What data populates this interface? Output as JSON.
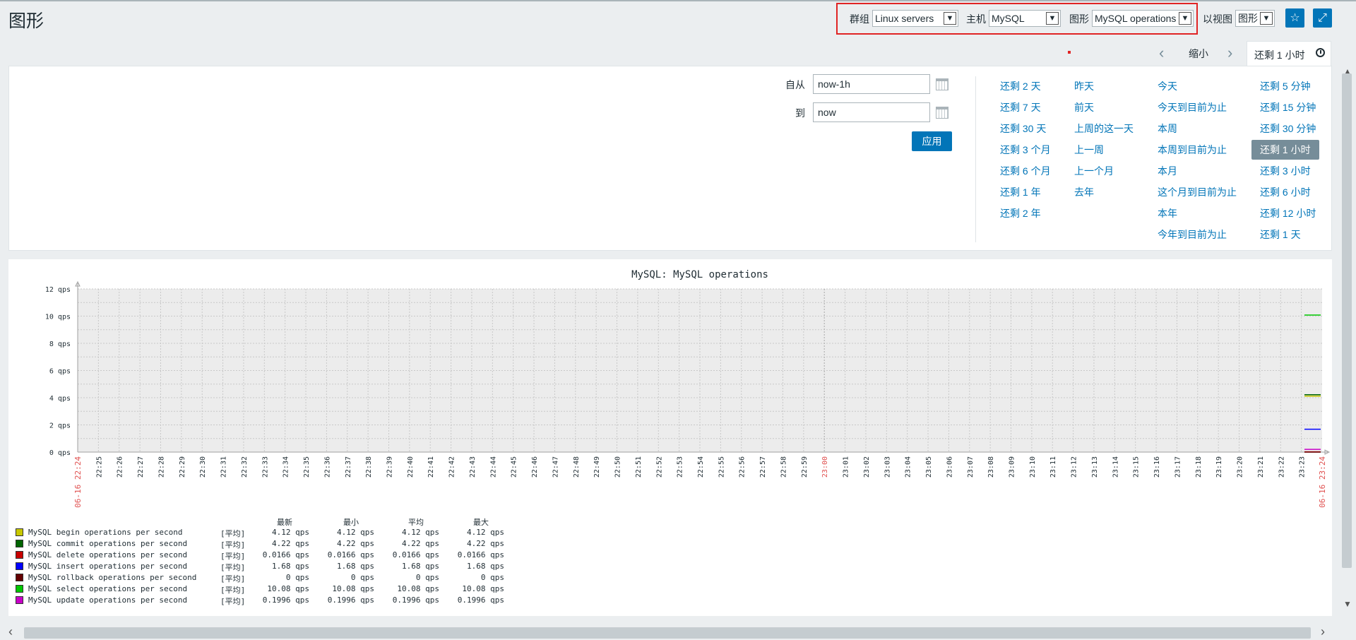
{
  "page": {
    "title": "图形"
  },
  "filters": {
    "group_label": "群组",
    "group_value": "Linux servers",
    "host_label": "主机",
    "host_value": "MySQL",
    "graph_label": "图形",
    "graph_value": "MySQL operations",
    "view_label": "以视图",
    "view_value": "图形"
  },
  "timebar": {
    "zoom_out": "缩小",
    "tab_label": "还剩 1 小时"
  },
  "timerange": {
    "from_label": "自从",
    "from_value": "now-1h",
    "to_label": "到",
    "to_value": "now",
    "apply_label": "应用",
    "quick": [
      [
        "还剩 2 天",
        "还剩 7 天",
        "还剩 30 天",
        "还剩 3 个月",
        "还剩 6 个月",
        "还剩 1 年",
        "还剩 2 年"
      ],
      [
        "昨天",
        "前天",
        "上周的这一天",
        "上一周",
        "上一个月",
        "去年"
      ],
      [
        "今天",
        "今天到目前为止",
        "本周",
        "本周到目前为止",
        "本月",
        "这个月到目前为止",
        "本年",
        "今年到目前为止"
      ],
      [
        "还剩 5 分钟",
        "还剩 15 分钟",
        "还剩 30 分钟",
        "还剩 1 小时",
        "还剩 3 小时",
        "还剩 6 小时",
        "还剩 12 小时",
        "还剩 1 天"
      ]
    ],
    "active": "还剩 1 小时"
  },
  "chart_data": {
    "type": "line",
    "title": "MySQL: MySQL operations",
    "y_unit": "qps",
    "y_ticks": [
      "0 qps",
      "2 qps",
      "4 qps",
      "6 qps",
      "8 qps",
      "10 qps",
      "12 qps"
    ],
    "ylim": [
      0,
      12
    ],
    "x_date_start": "06-16 22:24",
    "x_date_end": "06-16 23:24",
    "x_marker": "23:00",
    "x_ticks": [
      "22:25",
      "22:26",
      "22:27",
      "22:28",
      "22:29",
      "22:30",
      "22:31",
      "22:32",
      "22:33",
      "22:34",
      "22:35",
      "22:36",
      "22:37",
      "22:38",
      "22:39",
      "22:40",
      "22:41",
      "22:42",
      "22:43",
      "22:44",
      "22:45",
      "22:46",
      "22:47",
      "22:48",
      "22:49",
      "22:50",
      "22:51",
      "22:52",
      "22:53",
      "22:54",
      "22:55",
      "22:56",
      "22:57",
      "22:58",
      "22:59",
      "23:01",
      "23:02",
      "23:03",
      "23:04",
      "23:05",
      "23:06",
      "23:07",
      "23:08",
      "23:09",
      "23:10",
      "23:11",
      "23:12",
      "23:13",
      "23:14",
      "23:15",
      "23:16",
      "23:17",
      "23:18",
      "23:19",
      "23:20",
      "23:21",
      "23:22",
      "23:23"
    ],
    "legend_headers": [
      "最新",
      "最小",
      "平均",
      "最大"
    ],
    "series": [
      {
        "name": "MySQL begin operations per second",
        "agg": "[平均]",
        "color": "#c8c800",
        "last": "4.12 qps",
        "min": "4.12 qps",
        "avg": "4.12 qps",
        "max": "4.12 qps",
        "value": 4.12
      },
      {
        "name": "MySQL commit operations per second",
        "agg": "[平均]",
        "color": "#006400",
        "last": "4.22 qps",
        "min": "4.22 qps",
        "avg": "4.22 qps",
        "max": "4.22 qps",
        "value": 4.22
      },
      {
        "name": "MySQL delete operations per second",
        "agg": "[平均]",
        "color": "#c80000",
        "last": "0.0166 qps",
        "min": "0.0166 qps",
        "avg": "0.0166 qps",
        "max": "0.0166 qps",
        "value": 0.0166
      },
      {
        "name": "MySQL insert operations per second",
        "agg": "[平均]",
        "color": "#0000ff",
        "last": "1.68 qps",
        "min": "1.68 qps",
        "avg": "1.68 qps",
        "max": "1.68 qps",
        "value": 1.68
      },
      {
        "name": "MySQL rollback operations per second",
        "agg": "[平均]",
        "color": "#640000",
        "last": "0 qps",
        "min": "0 qps",
        "avg": "0 qps",
        "max": "0 qps",
        "value": 0
      },
      {
        "name": "MySQL select operations per second",
        "agg": "[平均]",
        "color": "#00c800",
        "last": "10.08 qps",
        "min": "10.08 qps",
        "avg": "10.08 qps",
        "max": "10.08 qps",
        "value": 10.08
      },
      {
        "name": "MySQL update operations per second",
        "agg": "[平均]",
        "color": "#c800c8",
        "last": "0.1996 qps",
        "min": "0.1996 qps",
        "avg": "0.1996 qps",
        "max": "0.1996 qps",
        "value": 0.1996
      }
    ]
  }
}
